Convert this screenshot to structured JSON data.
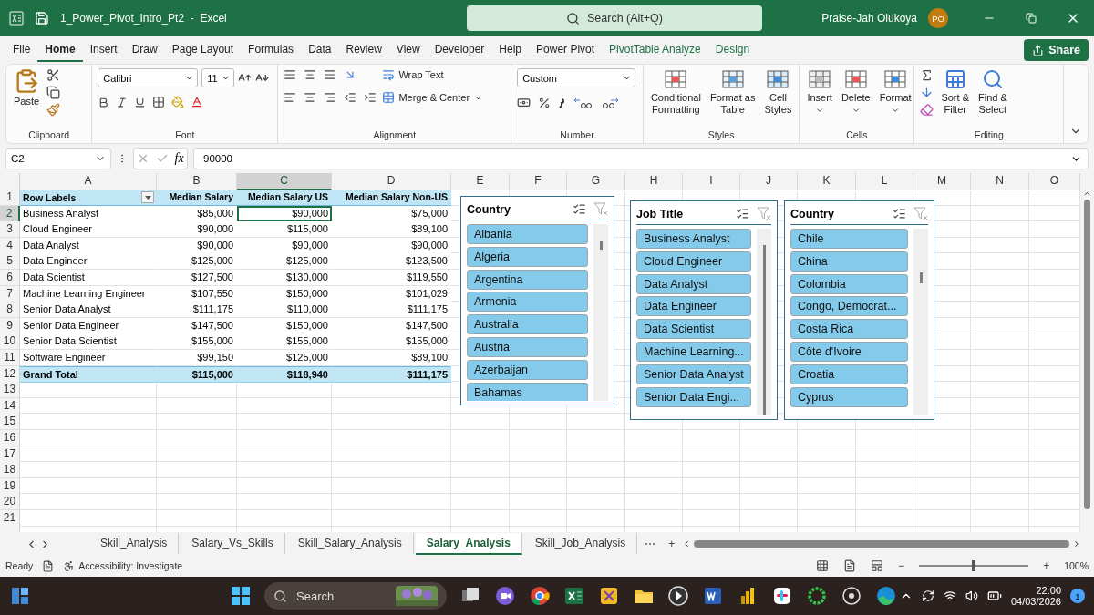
{
  "title_bar": {
    "file_name": "1_Power_Pivot_Intro_Pt2",
    "separator": "-",
    "app": "Excel",
    "search_placeholder": "Search (Alt+Q)",
    "user": "Praise-Jah Olukoya",
    "avatar": "PO"
  },
  "menu_tabs": [
    {
      "label": "File",
      "selected": false,
      "kind": "normal"
    },
    {
      "label": "Home",
      "selected": true,
      "kind": "normal"
    },
    {
      "label": "Insert",
      "selected": false,
      "kind": "normal"
    },
    {
      "label": "Draw",
      "selected": false,
      "kind": "normal"
    },
    {
      "label": "Page Layout",
      "selected": false,
      "kind": "normal"
    },
    {
      "label": "Formulas",
      "selected": false,
      "kind": "normal"
    },
    {
      "label": "Data",
      "selected": false,
      "kind": "normal"
    },
    {
      "label": "Review",
      "selected": false,
      "kind": "normal"
    },
    {
      "label": "View",
      "selected": false,
      "kind": "normal"
    },
    {
      "label": "Developer",
      "selected": false,
      "kind": "normal"
    },
    {
      "label": "Help",
      "selected": false,
      "kind": "normal"
    },
    {
      "label": "Power Pivot",
      "selected": false,
      "kind": "normal"
    },
    {
      "label": "PivotTable Analyze",
      "selected": false,
      "kind": "contextual"
    },
    {
      "label": "Design",
      "selected": false,
      "kind": "contextual"
    }
  ],
  "share": "Share",
  "ribbon": {
    "clipboard": {
      "label": "Clipboard",
      "paste": "Paste"
    },
    "font": {
      "label": "Font",
      "name": "Calibri",
      "size": "11"
    },
    "alignment": {
      "label": "Alignment",
      "wrap": "Wrap Text",
      "merge": "Merge & Center"
    },
    "number": {
      "label": "Number",
      "format": "Custom"
    },
    "styles": {
      "label": "Styles",
      "buttons": [
        {
          "lines": [
            "Conditional",
            "Formatting"
          ]
        },
        {
          "lines": [
            "Format as",
            "Table"
          ]
        },
        {
          "lines": [
            "Cell",
            "Styles"
          ]
        }
      ]
    },
    "cells": {
      "label": "Cells",
      "buttons": [
        {
          "lines": [
            "Insert"
          ]
        },
        {
          "lines": [
            "Delete"
          ]
        },
        {
          "lines": [
            "Format"
          ]
        }
      ]
    },
    "editing": {
      "label": "Editing",
      "buttons": [
        {
          "lines": [
            "Sort &",
            "Filter"
          ]
        },
        {
          "lines": [
            "Find &",
            "Select"
          ]
        }
      ]
    }
  },
  "formula_bar": {
    "name_box": "C2",
    "function_label": "fx",
    "value": "90000"
  },
  "columns": [
    {
      "letter": "A",
      "selected": false
    },
    {
      "letter": "B",
      "selected": false
    },
    {
      "letter": "C",
      "selected": true
    },
    {
      "letter": "D",
      "selected": false
    },
    {
      "letter": "E",
      "selected": false
    },
    {
      "letter": "F",
      "selected": false
    },
    {
      "letter": "G",
      "selected": false
    },
    {
      "letter": "H",
      "selected": false
    },
    {
      "letter": "I",
      "selected": false
    },
    {
      "letter": "J",
      "selected": false
    },
    {
      "letter": "K",
      "selected": false
    },
    {
      "letter": "L",
      "selected": false
    },
    {
      "letter": "M",
      "selected": false
    },
    {
      "letter": "N",
      "selected": false
    },
    {
      "letter": "O",
      "selected": false
    }
  ],
  "row_numbers": [
    {
      "label": "1",
      "selected": false
    },
    {
      "label": "2",
      "selected": true
    },
    {
      "label": "3",
      "selected": false
    },
    {
      "label": "4",
      "selected": false
    },
    {
      "label": "5",
      "selected": false
    },
    {
      "label": "6",
      "selected": false
    },
    {
      "label": "7",
      "selected": false
    },
    {
      "label": "8",
      "selected": false
    },
    {
      "label": "9",
      "selected": false
    },
    {
      "label": "10",
      "selected": false
    },
    {
      "label": "11",
      "selected": false
    },
    {
      "label": "12",
      "selected": false
    },
    {
      "label": "13",
      "selected": false
    },
    {
      "label": "14",
      "selected": false
    },
    {
      "label": "15",
      "selected": false
    },
    {
      "label": "16",
      "selected": false
    },
    {
      "label": "17",
      "selected": false
    },
    {
      "label": "18",
      "selected": false
    },
    {
      "label": "19",
      "selected": false
    },
    {
      "label": "20",
      "selected": false
    },
    {
      "label": "21",
      "selected": false
    }
  ],
  "pivot": {
    "headers": [
      "Row Labels",
      "Median Salary",
      "Median Salary US",
      "Median Salary Non-US"
    ],
    "rows": [
      {
        "label": "Business Analyst",
        "kind": "item",
        "values": [
          {
            "text": "$85,000",
            "selected": false
          },
          {
            "text": "$90,000",
            "selected": true
          },
          {
            "text": "$75,000",
            "selected": false
          }
        ]
      },
      {
        "label": "Cloud Engineer",
        "kind": "item",
        "values": [
          {
            "text": "$90,000",
            "selected": false
          },
          {
            "text": "$115,000",
            "selected": false
          },
          {
            "text": "$89,100",
            "selected": false
          }
        ]
      },
      {
        "label": "Data Analyst",
        "kind": "item",
        "values": [
          {
            "text": "$90,000",
            "selected": false
          },
          {
            "text": "$90,000",
            "selected": false
          },
          {
            "text": "$90,000",
            "selected": false
          }
        ]
      },
      {
        "label": "Data Engineer",
        "kind": "item",
        "values": [
          {
            "text": "$125,000",
            "selected": false
          },
          {
            "text": "$125,000",
            "selected": false
          },
          {
            "text": "$123,500",
            "selected": false
          }
        ]
      },
      {
        "label": "Data Scientist",
        "kind": "item",
        "values": [
          {
            "text": "$127,500",
            "selected": false
          },
          {
            "text": "$130,000",
            "selected": false
          },
          {
            "text": "$119,550",
            "selected": false
          }
        ]
      },
      {
        "label": "Machine Learning Engineer",
        "kind": "item",
        "values": [
          {
            "text": "$107,550",
            "selected": false
          },
          {
            "text": "$150,000",
            "selected": false
          },
          {
            "text": "$101,029",
            "selected": false
          }
        ]
      },
      {
        "label": "Senior Data Analyst",
        "kind": "item",
        "values": [
          {
            "text": "$111,175",
            "selected": false
          },
          {
            "text": "$110,000",
            "selected": false
          },
          {
            "text": "$111,175",
            "selected": false
          }
        ]
      },
      {
        "label": "Senior Data Engineer",
        "kind": "item",
        "values": [
          {
            "text": "$147,500",
            "selected": false
          },
          {
            "text": "$150,000",
            "selected": false
          },
          {
            "text": "$147,500",
            "selected": false
          }
        ]
      },
      {
        "label": "Senior Data Scientist",
        "kind": "item",
        "values": [
          {
            "text": "$155,000",
            "selected": false
          },
          {
            "text": "$155,000",
            "selected": false
          },
          {
            "text": "$155,000",
            "selected": false
          }
        ]
      },
      {
        "label": "Software Engineer",
        "kind": "item",
        "values": [
          {
            "text": "$99,150",
            "selected": false
          },
          {
            "text": "$125,000",
            "selected": false
          },
          {
            "text": "$89,100",
            "selected": false
          }
        ]
      },
      {
        "label": "Grand Total",
        "kind": "total",
        "values": [
          {
            "text": "$115,000",
            "selected": false
          },
          {
            "text": "$118,940",
            "selected": false
          },
          {
            "text": "$111,175",
            "selected": false
          }
        ]
      }
    ]
  },
  "slicers": [
    {
      "title": "Country",
      "items": [
        {
          "label": "Albania",
          "selected": true
        },
        {
          "label": "Algeria",
          "selected": true
        },
        {
          "label": "Argentina",
          "selected": true
        },
        {
          "label": "Armenia",
          "selected": true
        },
        {
          "label": "Australia",
          "selected": true
        },
        {
          "label": "Austria",
          "selected": true
        },
        {
          "label": "Azerbaijan",
          "selected": true
        },
        {
          "label": "Bahamas",
          "selected": true
        }
      ]
    },
    {
      "title": "Job Title",
      "items": [
        {
          "label": "Business Analyst",
          "selected": true
        },
        {
          "label": "Cloud Engineer",
          "selected": true
        },
        {
          "label": "Data Analyst",
          "selected": true
        },
        {
          "label": "Data Engineer",
          "selected": true
        },
        {
          "label": "Data Scientist",
          "selected": true
        },
        {
          "label": "Machine Learning...",
          "selected": true
        },
        {
          "label": "Senior Data Analyst",
          "selected": true
        },
        {
          "label": "Senior Data Engi...",
          "selected": true
        }
      ]
    },
    {
      "title": "Country",
      "items": [
        {
          "label": "Chile",
          "selected": true
        },
        {
          "label": "China",
          "selected": true
        },
        {
          "label": "Colombia",
          "selected": true
        },
        {
          "label": "Congo, Democrat...",
          "selected": true
        },
        {
          "label": "Costa Rica",
          "selected": true
        },
        {
          "label": "Côte d'Ivoire",
          "selected": true
        },
        {
          "label": "Croatia",
          "selected": true
        },
        {
          "label": "Cyprus",
          "selected": true
        }
      ]
    }
  ],
  "sheet_tabs": [
    {
      "label": "Skill_Analysis",
      "selected": false
    },
    {
      "label": "Salary_Vs_Skills",
      "selected": false
    },
    {
      "label": "Skill_Salary_Analysis",
      "selected": false
    },
    {
      "label": "Salary_Analysis",
      "selected": true
    },
    {
      "label": "Skill_Job_Analysis",
      "selected": false
    }
  ],
  "sheet_more": "⋯",
  "sheet_add": "+",
  "status_bar": {
    "mode": "Ready",
    "accessibility": "Accessibility: Investigate",
    "zoom_out": "−",
    "zoom_in": "+",
    "zoom": {
      "level": 0.5
    },
    "zoom_label": "100%"
  },
  "taskbar": {
    "search": "Search",
    "time": "22:00",
    "date": "04/03/2026",
    "notifications": "1"
  }
}
